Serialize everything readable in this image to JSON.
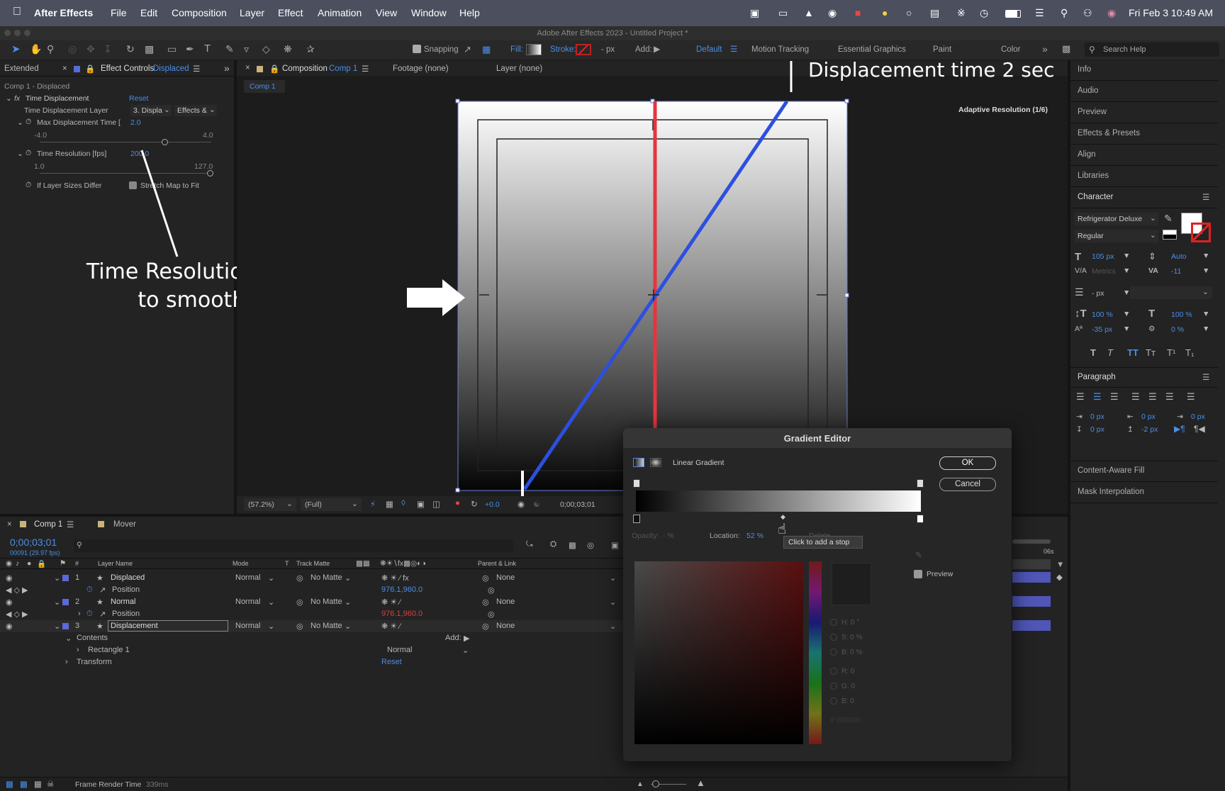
{
  "menubar": {
    "app": "After Effects",
    "items": [
      "File",
      "Edit",
      "Composition",
      "Layer",
      "Effect",
      "Animation",
      "View",
      "Window",
      "Help"
    ],
    "clock": "Fri Feb 3  10:49 AM"
  },
  "window_title": "Adobe After Effects 2023 - Untitled Project *",
  "toolbar": {
    "snapping": "Snapping",
    "fill": "Fill:",
    "stroke": "Stroke:",
    "px": "- px",
    "add": "Add:",
    "workspaces": [
      "Default",
      "Motion Tracking",
      "Essential Graphics",
      "Paint",
      "Color"
    ],
    "search": "Search Help"
  },
  "effect_panel": {
    "tab_extended": "Extended",
    "tab_label": "Effect Controls",
    "tab_layer": "Displaced",
    "subject": "Comp 1 - Displaced",
    "effect_name": "Time Displacement",
    "reset": "Reset",
    "layer_label": "Time Displacement Layer",
    "layer_value": "3. Displa",
    "layer_value2": "Effects &",
    "max_label": "Max Displacement Time [",
    "max_value": "2.0",
    "max_min": "-4.0",
    "max_max": "4.0",
    "res_label": "Time Resolution [fps]",
    "res_value": "200.0",
    "res_min": "1.0",
    "res_max": "127.0",
    "sizes_label": "If Layer Sizes Differ",
    "stretch_label": "Stretch Map to Fit"
  },
  "comp_panel": {
    "tab_label": "Composition",
    "tab_comp": "Comp 1",
    "footage": "Footage (none)",
    "layer": "Layer (none)",
    "crumb": "Comp 1",
    "adaptive": "Adaptive Resolution (1/6)",
    "zoom": "(57.2%)",
    "quality": "(Full)",
    "exposure": "+0.0",
    "timecode": "0;00;03;01"
  },
  "annotations": {
    "top": "Displacement time 2 sec",
    "left_line1": "Time Resolution Increase",
    "left_line2": "to smooth lines"
  },
  "right_panel": {
    "items_top": [
      "Info",
      "Audio",
      "Preview",
      "Effects & Presets",
      "Align",
      "Libraries"
    ],
    "character_title": "Character",
    "font": "Refrigerator Deluxe",
    "style": "Regular",
    "size": "105 px",
    "leading": "Auto",
    "kerning": "Metrics",
    "tracking": "-11",
    "stroke_px": "- px",
    "vscale": "100 %",
    "hscale": "100 %",
    "baseline": "-35 px",
    "tsume": "0 %",
    "paragraph_title": "Paragraph",
    "indent1": "0 px",
    "indent2": "0 px",
    "indent3": "0 px",
    "indent4": "0 px",
    "indent5": "-2 px",
    "items_bottom": [
      "Content-Aware Fill",
      "Mask Interpolation"
    ]
  },
  "timeline": {
    "tab_comp": "Comp 1",
    "tab_mover": "Mover",
    "timecode": "0;00;03;01",
    "frames": "00091 (29.97 fps)",
    "col_layer": "Layer Name",
    "col_mode": "Mode",
    "col_t": "T",
    "col_matte": "Track Matte",
    "col_parent": "Parent & Link",
    "layers": [
      {
        "num": "1",
        "name": "Displaced",
        "mode": "Normal",
        "matte": "No Matte",
        "parent": "None",
        "prop": "Position",
        "pos": "976.1,960.0"
      },
      {
        "num": "2",
        "name": "Normal",
        "mode": "Normal",
        "matte": "No Matte",
        "parent": "None",
        "prop": "Position",
        "pos": "976.1,960.0"
      },
      {
        "num": "3",
        "name": "Displacement",
        "mode": "Normal",
        "matte": "No Matte",
        "parent": "None"
      }
    ],
    "contents": "Contents",
    "add": "Add:",
    "rect": "Rectangle 1",
    "rect_mode": "Normal",
    "transform": "Transform",
    "reset": "Reset",
    "render_time": "Frame Render Time",
    "render_ms": "339ms",
    "ruler_end": "06s"
  },
  "gradient_editor": {
    "title": "Gradient Editor",
    "type": "Linear Gradient",
    "ok": "OK",
    "cancel": "Cancel",
    "opacity_label": "Opacity:",
    "opacity_value": "- %",
    "location_label": "Location:",
    "location_value": "52 %",
    "delete": "Delete",
    "tooltip": "Click to add a stop",
    "preview": "Preview",
    "h": "H: 0 °",
    "s": "S: 0 %",
    "b": "B: 0 %",
    "r": "R: 0",
    "g": "G: 0",
    "bb": "B: 0",
    "hex": "# 000000"
  },
  "colors": {
    "accent": "#4a8fe8",
    "red_line": "#e8343c",
    "blue_line": "#2d4fe0",
    "label": "#5a6ad6"
  }
}
